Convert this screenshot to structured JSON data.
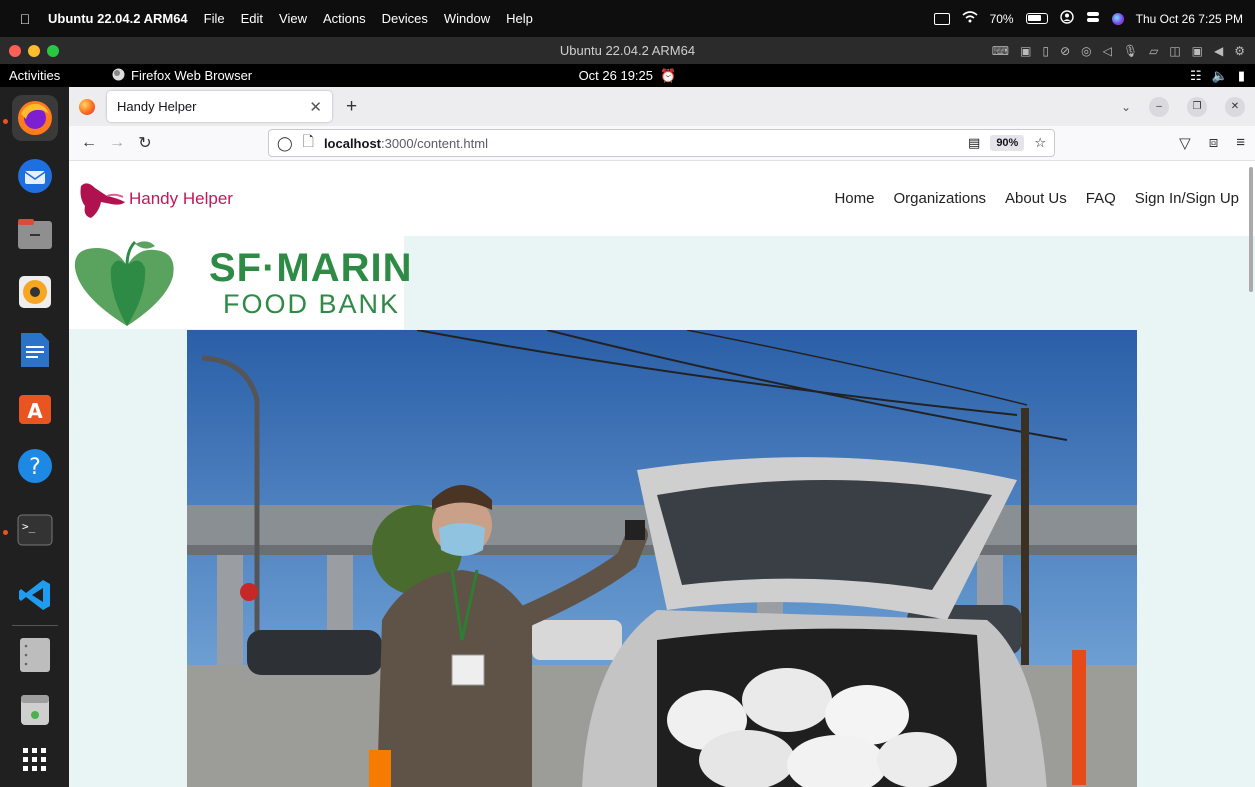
{
  "mac_menubar": {
    "app_name": "Ubuntu 22.04.2 ARM64",
    "menus": [
      "File",
      "Edit",
      "View",
      "Actions",
      "Devices",
      "Window",
      "Help"
    ],
    "battery_percent": "70%",
    "datetime": "Thu Oct 26  7:25 PM"
  },
  "vm_window": {
    "title": "Ubuntu 22.04.2 ARM64"
  },
  "ubuntu_topbar": {
    "activities": "Activities",
    "app_indicator": "Firefox Web Browser",
    "clock": "Oct 26  19:25"
  },
  "dock": {
    "items": [
      "firefox",
      "thunderbird",
      "files",
      "rhythmbox",
      "libreoffice-writer",
      "app-center",
      "help",
      "terminal",
      "vscode",
      "drive",
      "trash",
      "show-apps"
    ]
  },
  "firefox": {
    "tab_title": "Handy Helper",
    "url_host": "localhost",
    "url_path": ":3000/content.html",
    "zoom": "90%"
  },
  "site": {
    "logo_text": "Handy Helper",
    "nav": {
      "home": "Home",
      "organizations": "Organizations",
      "about": "About Us",
      "faq": "FAQ",
      "signin": "Sign In/Sign Up"
    },
    "partner": {
      "line1": "SF·MARIN",
      "line2": "FOOD BANK"
    }
  },
  "colors": {
    "brand_pink": "#c2185b",
    "foodbank_green": "#2e8b45",
    "page_bg": "#e9f5f5"
  }
}
